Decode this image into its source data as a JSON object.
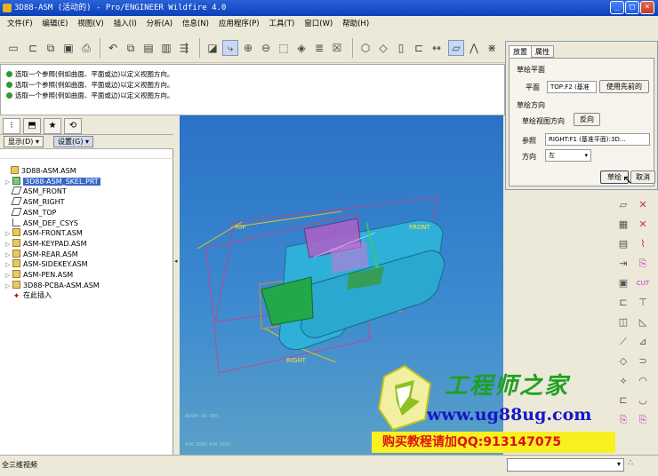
{
  "window": {
    "title": "3D88-ASM (活动的) - Pro/ENGINEER Wildfire 4.0",
    "min": "_",
    "max": "□",
    "close": "×"
  },
  "menu": [
    "文件(F)",
    "编辑(E)",
    "视图(V)",
    "插入(I)",
    "分析(A)",
    "信息(N)",
    "应用程序(P)",
    "工具(T)",
    "窗口(W)",
    "帮助(H)"
  ],
  "messages": [
    "选取一个参照(例如曲面、平面或边)以定义视图方向。",
    "选取一个参照(例如曲面、平面或边)以定义视图方向。",
    "选取一个参照(例如曲面、平面或边)以定义视图方向。"
  ],
  "sketch_dialog": {
    "tabs": [
      "放置",
      "属性"
    ],
    "sketch_plane_header": "草绘平面",
    "plane_label": "平面",
    "plane_value": "TOP:F2 (基准",
    "use_prev_button": "使用先前的",
    "orientation_header": "草绘方向",
    "view_dir_label": "草绘视图方向",
    "flip_button": "反向",
    "ref_label": "参照",
    "ref_value": "RIGHT:F1 (基准平面):3D...",
    "direction_label": "方向",
    "direction_value": "左",
    "sketch_button": "草绘",
    "cancel_button": "取消"
  },
  "model_tree": {
    "show_button": "显示(D) ▾",
    "settings_button": "设置(G) ▾",
    "items": [
      {
        "label": "3D88-ASM.ASM",
        "kind": "asm",
        "level": 0,
        "expand": ""
      },
      {
        "label": "3D88-ASM_SKEL.PRT",
        "kind": "prt",
        "level": 1,
        "expand": "▷",
        "selected": true
      },
      {
        "label": "ASM_FRONT",
        "kind": "plane",
        "level": 1,
        "expand": ""
      },
      {
        "label": "ASM_RIGHT",
        "kind": "plane",
        "level": 1,
        "expand": ""
      },
      {
        "label": "ASM_TOP",
        "kind": "plane",
        "level": 1,
        "expand": ""
      },
      {
        "label": "ASM_DEF_CSYS",
        "kind": "csys",
        "level": 1,
        "expand": ""
      },
      {
        "label": "ASM-FRONT.ASM",
        "kind": "asm",
        "level": 1,
        "expand": "▷"
      },
      {
        "label": "ASM-KEYPAD.ASM",
        "kind": "asm",
        "level": 1,
        "expand": "▷"
      },
      {
        "label": "ASM-REAR.ASM",
        "kind": "asm",
        "level": 1,
        "expand": "▷"
      },
      {
        "label": "ASM-SIDEKEY.ASM",
        "kind": "asm",
        "level": 1,
        "expand": "▷"
      },
      {
        "label": "ASM-PEN.ASM",
        "kind": "asm",
        "level": 1,
        "expand": "▷"
      },
      {
        "label": "3D88-PCBA-ASM.ASM",
        "kind": "asm",
        "level": 1,
        "expand": "▷"
      },
      {
        "label": "在此插入",
        "kind": "ins",
        "level": 1,
        "expand": ""
      }
    ]
  },
  "viewport": {
    "label_front": "FRONT",
    "label_right": "RIGHT",
    "label_top": "TOP",
    "small1": "WDRAM-3D-SKEL",
    "small2": "ASM.3D88-ASM.ASSY"
  },
  "watermark": {
    "title": "工程师之家",
    "url": "www.ug88ug.com",
    "promo": "购买教程请加QQ:913147075"
  },
  "status": {
    "left": "全三维视频"
  }
}
